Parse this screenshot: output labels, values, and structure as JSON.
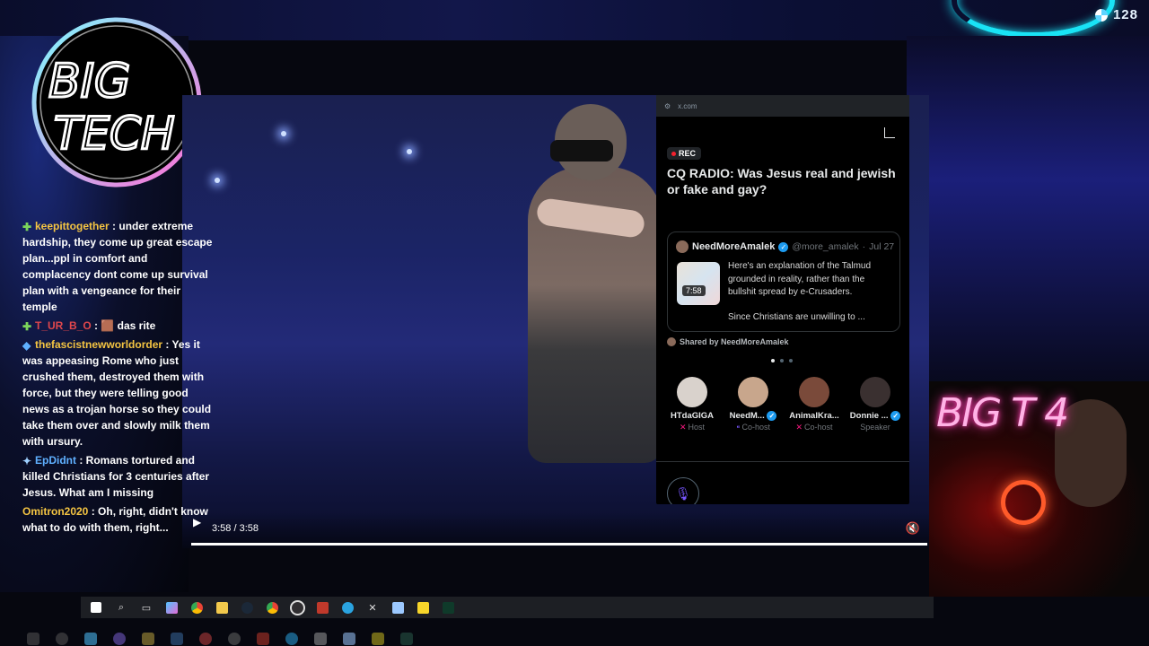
{
  "viewer_count": "128",
  "logo": {
    "text": "BIG TECH"
  },
  "chat": [
    {
      "user": "keepittogether",
      "user_color": "yellow",
      "text": ": under extreme hardship, they come up great escape plan...ppl in comfort and complacency dont come up survival plan with a vengeance for their temple"
    },
    {
      "user": "T_UR_B_O",
      "user_color": "red",
      "text": ": 🟫 das rite"
    },
    {
      "user": "thefascistnewworldorder",
      "user_color": "yellow",
      "text": ": Yes it was appeasing Rome who just crushed them, destroyed them with force, but they were telling good news as a trojan horse so they could take them over and slowly milk them with ursury."
    },
    {
      "user": "EpDidnt",
      "user_color": "blue",
      "text": ": Romans tortured and killed Christians for 3 centuries after Jesus. What am I missing"
    },
    {
      "user": "Omitron2020",
      "user_color": "yellow",
      "text": ": Oh, right, didn't know what to do with them, right..."
    }
  ],
  "video": {
    "time": "3:58 / 3:58",
    "progress": 1.0
  },
  "space": {
    "url": "x.com",
    "rec_label": "REC",
    "title": "CQ RADIO: Was Jesus real and jewish or fake and gay?",
    "shared_post": {
      "author": "NeedMoreAmalek",
      "handle": "@more_amalek",
      "date": "Jul 27",
      "duration": "7:58",
      "text": "Here's an explanation of the Talmud grounded in reality, rather than the bullshit spread by e-Crusaders.",
      "more_text": "Since Christians are unwilling to ..."
    },
    "shared_by": "Shared by NeedMoreAmalek",
    "participants": [
      {
        "name": "HTdaGIGA",
        "role": "Host",
        "avatar_color": "#d9d2cc"
      },
      {
        "name": "NeedM...",
        "role": "Co-host",
        "avatar_color": "#c8a68c"
      },
      {
        "name": "AnimalKra...",
        "role": "Co-host",
        "avatar_color": "#7a4a3a"
      },
      {
        "name": "Donnie ...",
        "role": "Speaker",
        "avatar_color": "#3a3030"
      }
    ]
  },
  "webcam": {
    "neon_text": "BIG T  4"
  },
  "taskbar": {
    "icons": [
      "windows-icon",
      "search-icon",
      "task-view-icon",
      "copilot-icon",
      "chrome-icon",
      "file-explorer-icon",
      "steam-icon",
      "chrome-icon",
      "obs-icon",
      "app-icon",
      "telegram-icon",
      "x-icon",
      "notepad-icon",
      "sticky-notes-icon",
      "terminal-icon"
    ]
  }
}
